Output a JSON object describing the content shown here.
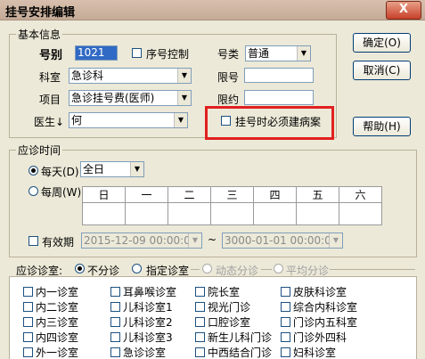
{
  "window": {
    "title": "挂号安排编辑",
    "close": "X"
  },
  "basic": {
    "legend": "基本信息",
    "number_label": "号别",
    "number_value": "1021",
    "seq_ctrl_label": "序号控制",
    "type_label": "号类",
    "type_value": "普通",
    "dept_label": "科室",
    "dept_value": "急诊科",
    "limit_label": "限号",
    "item_label": "项目",
    "item_value": "急诊挂号费(医师)",
    "appt_label": "限约",
    "doctor_label": "医生",
    "doctor_value": "何",
    "must_record_label": "挂号时必须建病案"
  },
  "buttons": {
    "ok": "确定(O)",
    "cancel": "取消(C)",
    "help": "帮助(H)"
  },
  "time": {
    "legend": "应诊时间",
    "daily_label": "每天(D)",
    "daily_value": "全日",
    "weekly_label": "每周(W)",
    "weekdays": [
      "日",
      "一",
      "二",
      "三",
      "四",
      "五",
      "六"
    ],
    "valid_label": "有效期",
    "start": "2015-12-09 00:00:00",
    "tilde": "~",
    "end": "3000-01-01 00:00:00"
  },
  "rooms": {
    "legend": "应诊诊室:",
    "mode_none": "不分诊",
    "mode_specified": "指定诊室",
    "mode_dynamic": "动态分诊",
    "mode_average": "平均分诊",
    "col1": [
      "内一诊室",
      "内二诊室",
      "内三诊室",
      "内四诊室",
      "外一诊室"
    ],
    "col2": [
      "耳鼻喉诊室",
      "儿科诊室1",
      "儿科诊室2",
      "儿科诊室3",
      "急诊诊室"
    ],
    "col3": [
      "院长室",
      "视光门诊",
      "口腔诊室",
      "新生儿科门诊",
      "中西结合门诊"
    ],
    "col4": [
      "皮肤科诊室",
      "综合内科诊室",
      "门诊内五科室",
      "门诊外四科",
      "妇科诊室"
    ]
  }
}
